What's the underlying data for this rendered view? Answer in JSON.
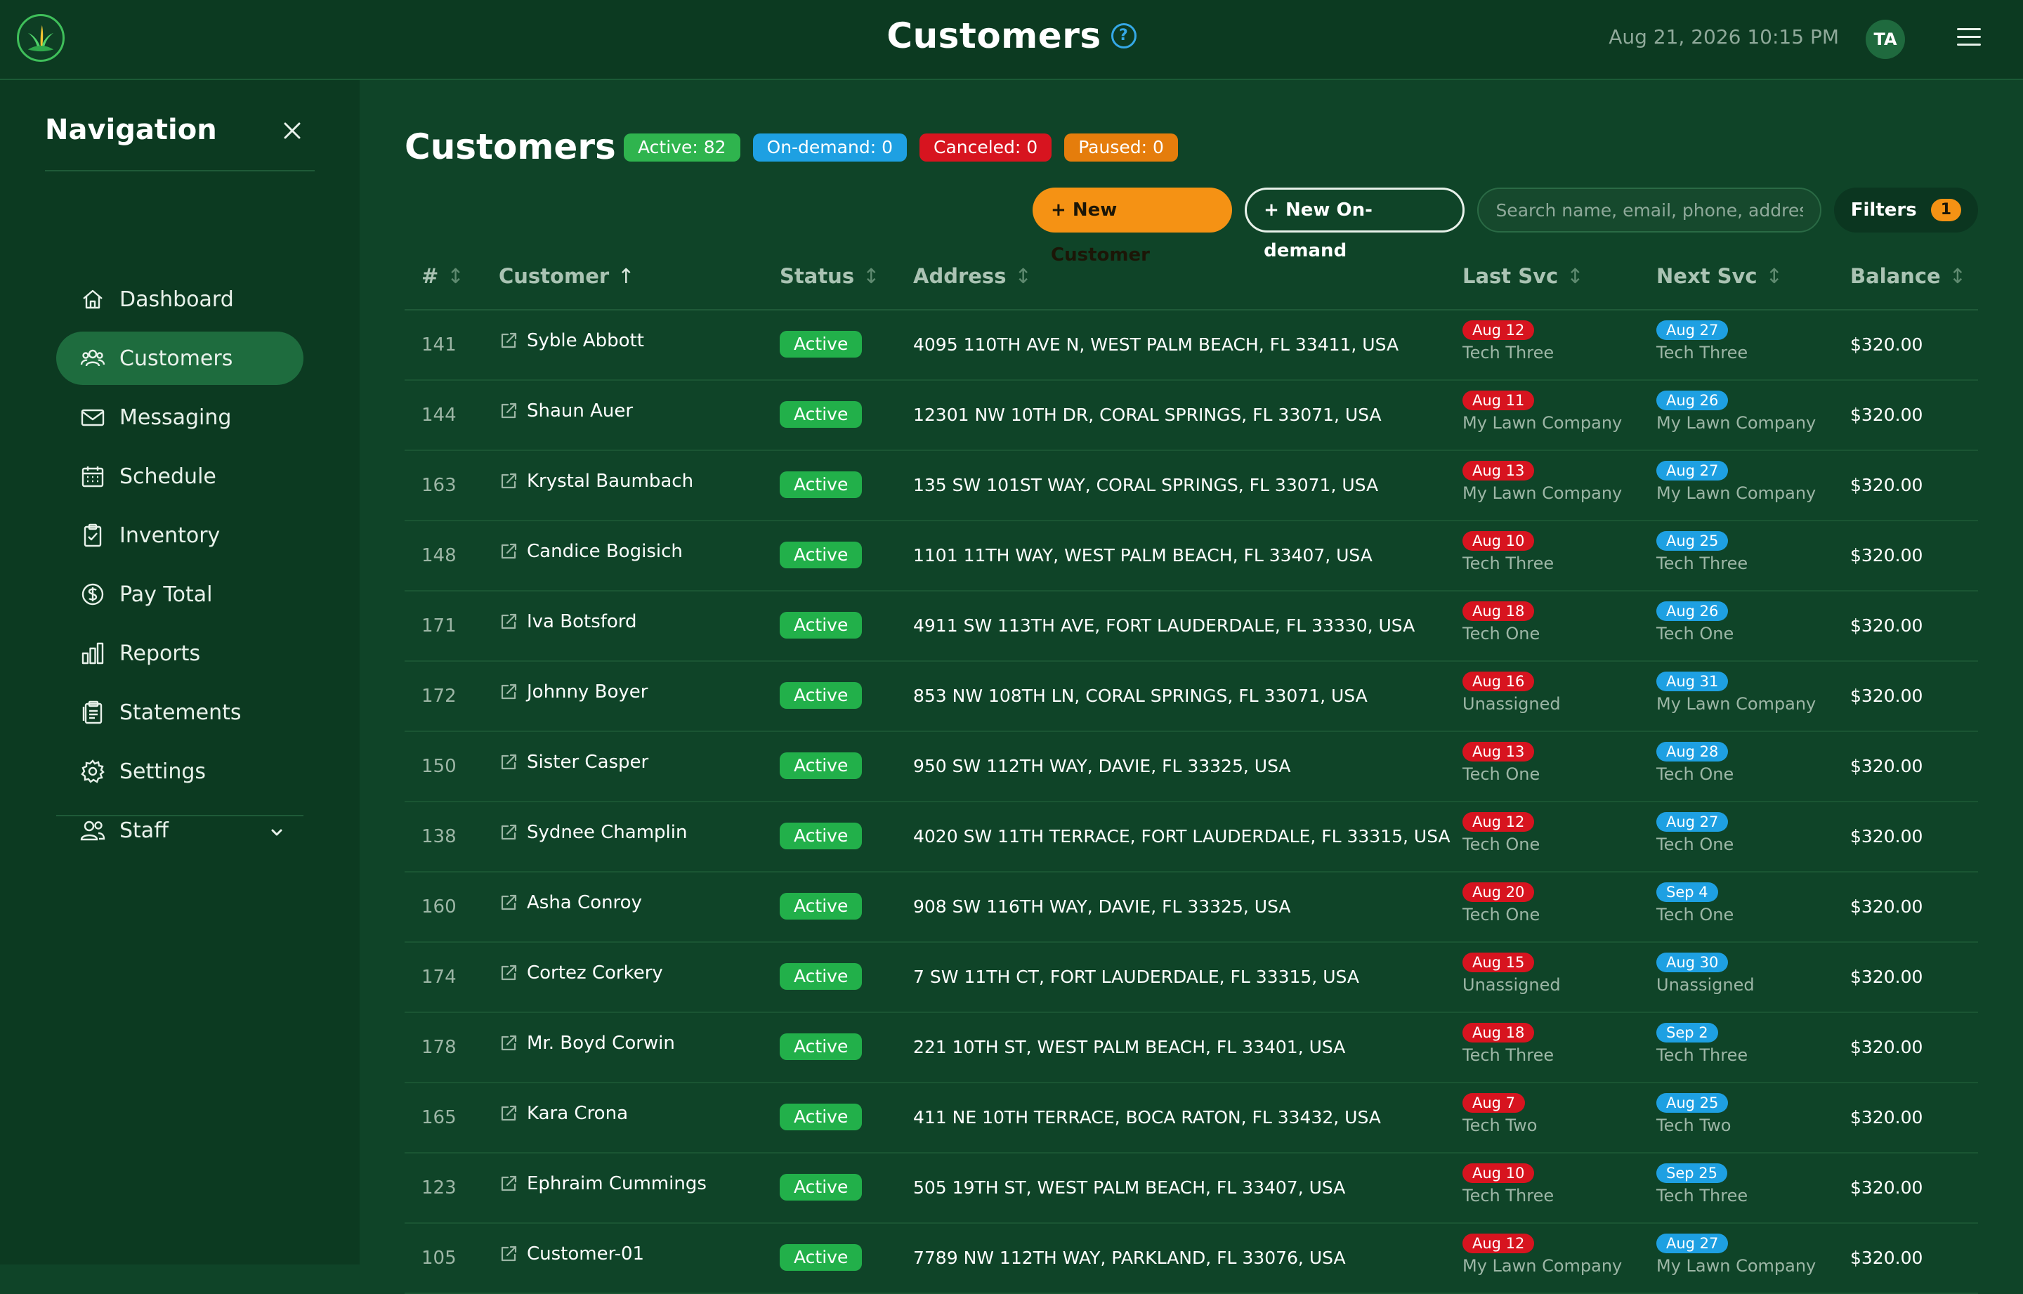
{
  "header": {
    "title": "Customers",
    "help_icon_glyph": "?",
    "datetime": "Aug 21, 2026 10:15 PM",
    "avatar_initials": "TA"
  },
  "sidebar": {
    "title": "Navigation",
    "items": [
      {
        "label": "Dashboard",
        "icon": "home-icon"
      },
      {
        "label": "Customers",
        "icon": "users-icon",
        "active": true
      },
      {
        "label": "Messaging",
        "icon": "mail-icon"
      },
      {
        "label": "Schedule",
        "icon": "calendar-icon"
      },
      {
        "label": "Inventory",
        "icon": "clipboard-icon"
      },
      {
        "label": "Pay Total",
        "icon": "dollar-icon"
      },
      {
        "label": "Reports",
        "icon": "bar-chart-icon"
      },
      {
        "label": "Statements",
        "icon": "document-icon"
      },
      {
        "label": "Settings",
        "icon": "gear-icon"
      },
      {
        "label": "Staff",
        "icon": "staff-icon"
      }
    ]
  },
  "main": {
    "title": "Customers",
    "badges": {
      "active": "Active: 82",
      "ondemand": "On-demand: 0",
      "canceled": "Canceled: 0",
      "paused": "Paused: 0"
    },
    "toolbar": {
      "new_customer": "+ New Customer",
      "new_ondemand": "+ New On-demand",
      "search_placeholder": "Search name, email, phone, address",
      "filters_label": "Filters",
      "filters_count": "1"
    },
    "columns": {
      "num": "#",
      "customer": "Customer",
      "status": "Status",
      "address": "Address",
      "last": "Last Svc",
      "next": "Next Svc",
      "balance": "Balance",
      "sort_neutral": "↕",
      "sort_asc": "↑"
    },
    "rows": [
      {
        "num": "141",
        "name": "Syble Abbott",
        "status": "Active",
        "address": "4095 110TH AVE N, WEST PALM BEACH, FL 33411, USA",
        "last_date": "Aug 12",
        "last_tech": "Tech Three",
        "next_date": "Aug 27",
        "next_tech": "Tech Three",
        "balance": "$320.00"
      },
      {
        "num": "144",
        "name": "Shaun Auer",
        "status": "Active",
        "address": "12301 NW 10TH DR, CORAL SPRINGS, FL 33071, USA",
        "last_date": "Aug 11",
        "last_tech": "My Lawn Company",
        "next_date": "Aug 26",
        "next_tech": "My Lawn Company",
        "balance": "$320.00"
      },
      {
        "num": "163",
        "name": "Krystal Baumbach",
        "status": "Active",
        "address": "135 SW 101ST WAY, CORAL SPRINGS, FL 33071, USA",
        "last_date": "Aug 13",
        "last_tech": "My Lawn Company",
        "next_date": "Aug 27",
        "next_tech": "My Lawn Company",
        "balance": "$320.00"
      },
      {
        "num": "148",
        "name": "Candice Bogisich",
        "status": "Active",
        "address": "1101 11TH WAY, WEST PALM BEACH, FL 33407, USA",
        "last_date": "Aug 10",
        "last_tech": "Tech Three",
        "next_date": "Aug 25",
        "next_tech": "Tech Three",
        "balance": "$320.00"
      },
      {
        "num": "171",
        "name": "Iva Botsford",
        "status": "Active",
        "address": "4911 SW 113TH AVE, FORT LAUDERDALE, FL 33330, USA",
        "last_date": "Aug 18",
        "last_tech": "Tech One",
        "next_date": "Aug 26",
        "next_tech": "Tech One",
        "balance": "$320.00"
      },
      {
        "num": "172",
        "name": "Johnny Boyer",
        "status": "Active",
        "address": "853 NW 108TH LN, CORAL SPRINGS, FL 33071, USA",
        "last_date": "Aug 16",
        "last_tech": "Unassigned",
        "next_date": "Aug 31",
        "next_tech": "My Lawn Company",
        "balance": "$320.00"
      },
      {
        "num": "150",
        "name": "Sister Casper",
        "status": "Active",
        "address": "950 SW 112TH WAY, DAVIE, FL 33325, USA",
        "last_date": "Aug 13",
        "last_tech": "Tech One",
        "next_date": "Aug 28",
        "next_tech": "Tech One",
        "balance": "$320.00"
      },
      {
        "num": "138",
        "name": "Sydnee Champlin",
        "status": "Active",
        "address": "4020 SW 11TH TERRACE, FORT LAUDERDALE, FL 33315, USA",
        "last_date": "Aug 12",
        "last_tech": "Tech One",
        "next_date": "Aug 27",
        "next_tech": "Tech One",
        "balance": "$320.00"
      },
      {
        "num": "160",
        "name": "Asha Conroy",
        "status": "Active",
        "address": "908 SW 116TH WAY, DAVIE, FL 33325, USA",
        "last_date": "Aug 20",
        "last_tech": "Tech One",
        "next_date": "Sep 4",
        "next_tech": "Tech One",
        "balance": "$320.00"
      },
      {
        "num": "174",
        "name": "Cortez Corkery",
        "status": "Active",
        "address": "7 SW 11TH CT, FORT LAUDERDALE, FL 33315, USA",
        "last_date": "Aug 15",
        "last_tech": "Unassigned",
        "next_date": "Aug 30",
        "next_tech": "Unassigned",
        "balance": "$320.00"
      },
      {
        "num": "178",
        "name": "Mr. Boyd Corwin",
        "status": "Active",
        "address": "221 10TH ST, WEST PALM BEACH, FL 33401, USA",
        "last_date": "Aug 18",
        "last_tech": "Tech Three",
        "next_date": "Sep 2",
        "next_tech": "Tech Three",
        "balance": "$320.00"
      },
      {
        "num": "165",
        "name": "Kara Crona",
        "status": "Active",
        "address": "411 NE 10TH TERRACE, BOCA RATON, FL 33432, USA",
        "last_date": "Aug 7",
        "last_tech": "Tech Two",
        "next_date": "Aug 25",
        "next_tech": "Tech Two",
        "balance": "$320.00"
      },
      {
        "num": "123",
        "name": "Ephraim Cummings",
        "status": "Active",
        "address": "505 19TH ST, WEST PALM BEACH, FL 33407, USA",
        "last_date": "Aug 10",
        "last_tech": "Tech Three",
        "next_date": "Sep 25",
        "next_tech": "Tech Three",
        "balance": "$320.00"
      },
      {
        "num": "105",
        "name": "Customer-01",
        "status": "Active",
        "address": "7789 NW 112TH WAY, PARKLAND, FL 33076, USA",
        "last_date": "Aug 12",
        "last_tech": "My Lawn Company",
        "next_date": "Aug 27",
        "next_tech": "My Lawn Company",
        "balance": "$320.00"
      }
    ]
  },
  "colors": {
    "background": "#0f4428",
    "sidebar": "#0c3a21",
    "accent_orange": "#f59214",
    "active_green": "#22b04a",
    "ondemand_blue": "#1ea0e2",
    "canceled_red": "#d7141f",
    "paused_orange": "#e57d0c"
  }
}
